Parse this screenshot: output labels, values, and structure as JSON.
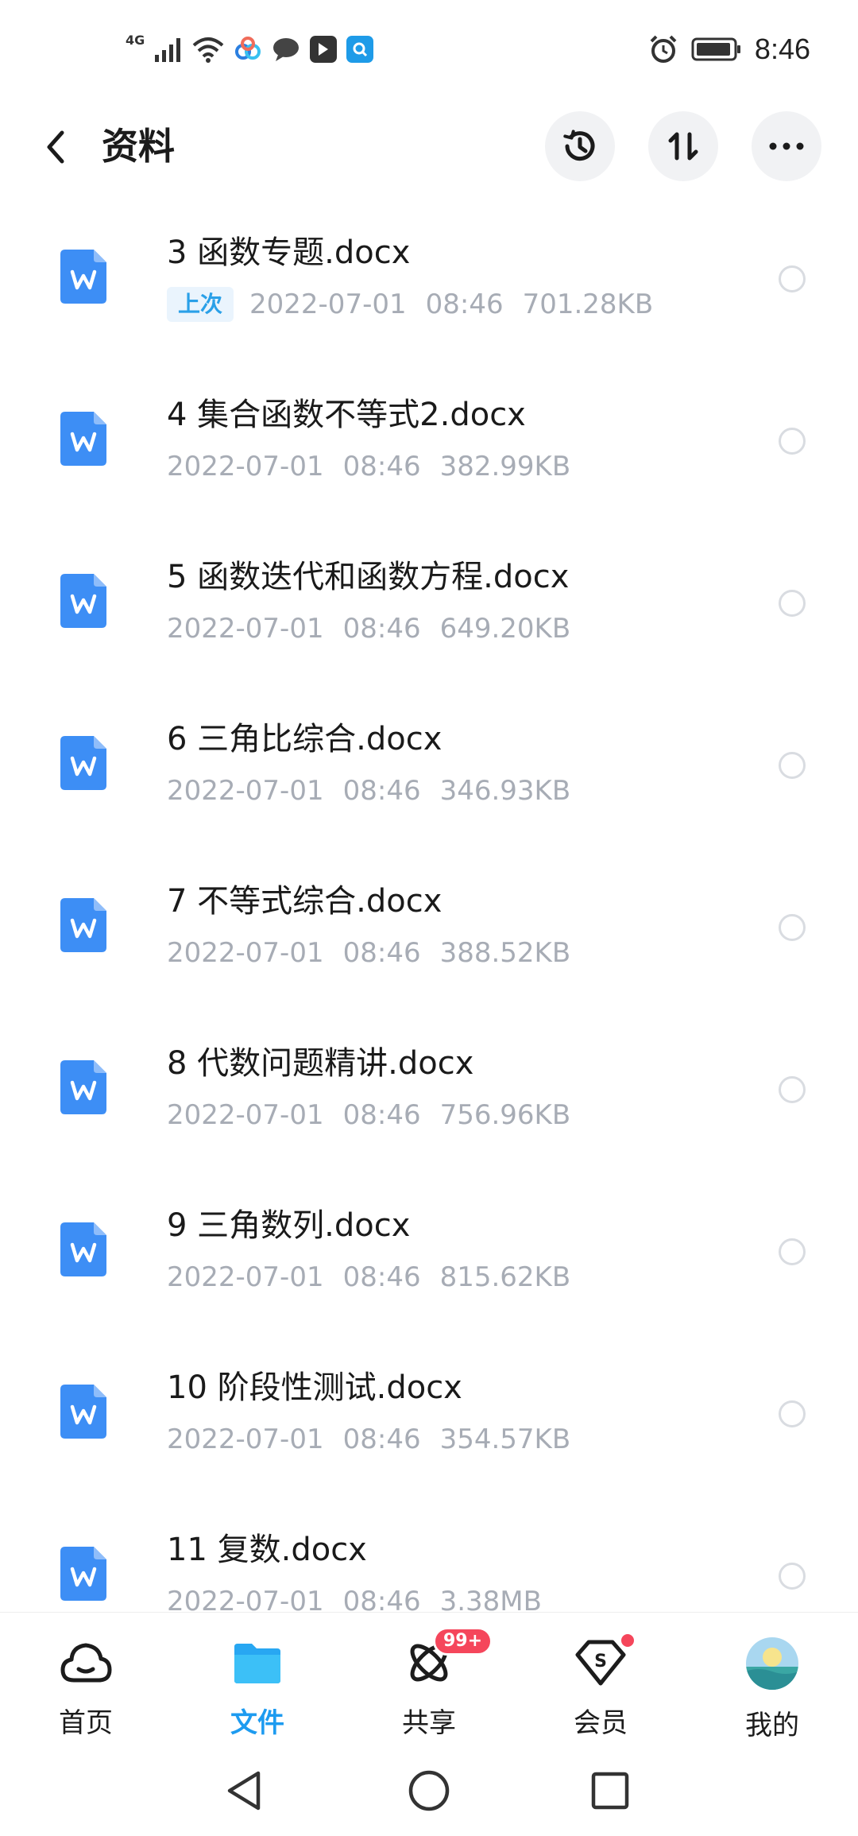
{
  "status_bar": {
    "network": "4G",
    "time": "8:46"
  },
  "header": {
    "title": "资料",
    "icons": [
      "back-icon",
      "history-icon",
      "sort-icon",
      "more-icon"
    ]
  },
  "files": [
    {
      "name": "3 函数专题.docx",
      "badge": "上次",
      "date": "2022-07-01",
      "time": "08:46",
      "size": "701.28KB"
    },
    {
      "name": "4 集合函数不等式2.docx",
      "date": "2022-07-01",
      "time": "08:46",
      "size": "382.99KB"
    },
    {
      "name": "5 函数迭代和函数方程.docx",
      "date": "2022-07-01",
      "time": "08:46",
      "size": "649.20KB"
    },
    {
      "name": "6 三角比综合.docx",
      "date": "2022-07-01",
      "time": "08:46",
      "size": "346.93KB"
    },
    {
      "name": "7 不等式综合.docx",
      "date": "2022-07-01",
      "time": "08:46",
      "size": "388.52KB"
    },
    {
      "name": "8 代数问题精讲.docx",
      "date": "2022-07-01",
      "time": "08:46",
      "size": "756.96KB"
    },
    {
      "name": "9 三角数列.docx",
      "date": "2022-07-01",
      "time": "08:46",
      "size": "815.62KB"
    },
    {
      "name": "10 阶段性测试.docx",
      "date": "2022-07-01",
      "time": "08:46",
      "size": "354.57KB"
    },
    {
      "name": "11 复数.docx",
      "date": "2022-07-01",
      "time": "08:46",
      "size": "3.38MB"
    }
  ],
  "bottom_nav": {
    "home": {
      "label": "首页"
    },
    "files": {
      "label": "文件"
    },
    "share": {
      "label": "共享",
      "badge": "99+"
    },
    "vip": {
      "label": "会员"
    },
    "mine": {
      "label": "我的"
    }
  },
  "colors": {
    "accent": "#1d9bf0",
    "word_icon": "#3d8ef5",
    "badge_red": "#f5465b",
    "meta_gray": "#a7acb5"
  }
}
